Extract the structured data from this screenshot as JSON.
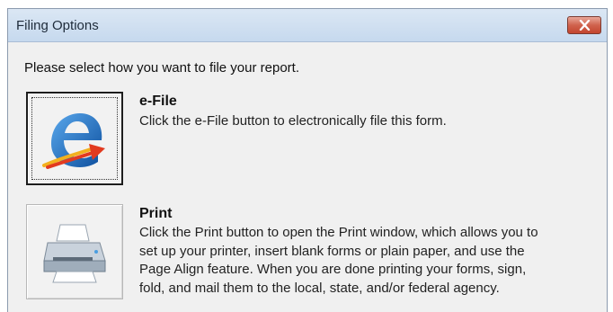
{
  "window": {
    "title": "Filing Options"
  },
  "prompt": "Please select how you want to file your report.",
  "options": [
    {
      "title": "e-File",
      "description": "Click the e-File button to electronically file this form.",
      "icon": "efile-logo-icon"
    },
    {
      "title": "Print",
      "description": "Click the Print button to open the Print window, which allows you to\nset up your printer, insert blank forms or plain paper, and use the\nPage Align feature. When you are done printing your forms, sign,\nfold, and mail them to the local, state, and/or federal agency.",
      "icon": "printer-icon"
    }
  ],
  "colors": {
    "titlebar": "#c6d9ee",
    "close_button": "#c3452e",
    "efile_blue": "#1d6fc4",
    "efile_arrow": "#e23a1f"
  }
}
